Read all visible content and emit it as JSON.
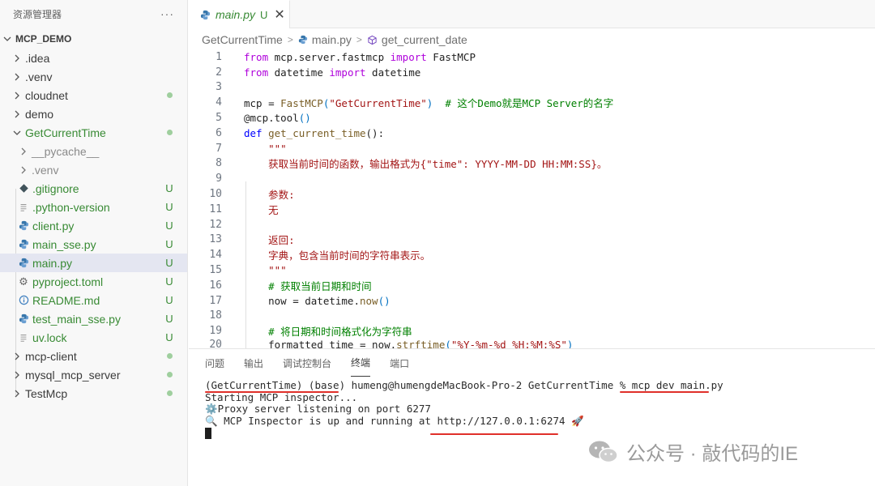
{
  "sidebar": {
    "title": "资源管理器",
    "more": "···",
    "root": "MCP_DEMO",
    "items": [
      {
        "label": ".idea",
        "status": ""
      },
      {
        "label": ".venv",
        "status": ""
      },
      {
        "label": "cloudnet",
        "status": "dot"
      },
      {
        "label": "demo",
        "status": ""
      },
      {
        "label": "GetCurrentTime",
        "status": "dot"
      },
      {
        "label": "__pycache__",
        "status": ""
      },
      {
        "label": ".venv",
        "status": ""
      },
      {
        "label": ".gitignore",
        "status": "U"
      },
      {
        "label": ".python-version",
        "status": "U"
      },
      {
        "label": "client.py",
        "status": "U"
      },
      {
        "label": "main_sse.py",
        "status": "U"
      },
      {
        "label": "main.py",
        "status": "U"
      },
      {
        "label": "pyproject.toml",
        "status": "U"
      },
      {
        "label": "README.md",
        "status": "U"
      },
      {
        "label": "test_main_sse.py",
        "status": "U"
      },
      {
        "label": "uv.lock",
        "status": "U"
      },
      {
        "label": "mcp-client",
        "status": "dot"
      },
      {
        "label": "mysql_mcp_server",
        "status": "dot"
      },
      {
        "label": "TestMcp",
        "status": "dot"
      }
    ]
  },
  "tab": {
    "label": "main.py",
    "status": "U",
    "close": "✕"
  },
  "breadcrumb": {
    "folder": "GetCurrentTime",
    "file": "main.py",
    "symbol": "get_current_date"
  },
  "code": {
    "line_numbers": [
      "1",
      "2",
      "3",
      "4",
      "5",
      "6",
      "7",
      "8",
      "9",
      "10",
      "11",
      "12",
      "13",
      "14",
      "15",
      "16",
      "17",
      "18",
      "19",
      "20"
    ],
    "l1": {
      "a": "from",
      "b": " mcp.server.fastmcp ",
      "c": "import",
      "d": " FastMCP"
    },
    "l2": {
      "a": "from",
      "b": " datetime ",
      "c": "import",
      "d": " datetime"
    },
    "l4": {
      "a": "mcp = ",
      "b": "FastMCP",
      "c": "(",
      "d": "\"GetCurrentTime\"",
      "e": ")",
      "f": "  # 这个Demo就是MCP Server的名字"
    },
    "l5": {
      "a": "@mcp.tool",
      "b": "()"
    },
    "l6": {
      "a": "def",
      "b": " ",
      "c": "get_current_time",
      "d": "():"
    },
    "l7": "    \"\"\"",
    "l8": "    获取当前时间的函数，输出格式为{\"time\": YYYY-MM-DD HH:MM:SS}。",
    "l10": "    参数:",
    "l11": "    无",
    "l13": "    返回:",
    "l14": "    字典，包含当前时间的字符串表示。",
    "l15": "    \"\"\"",
    "l16": "    # 获取当前日期和时间",
    "l17": {
      "a": "    now = datetime.",
      "b": "now",
      "c": "()"
    },
    "l19": "    # 将日期和时间格式化为字符串",
    "l20": {
      "a": "    formatted_time = now.",
      "b": "strftime",
      "c": "(",
      "d": "\"%Y-%m-%d %H:%M:%S\"",
      "e": ")"
    }
  },
  "panel": {
    "tabs": [
      "问题",
      "输出",
      "调试控制台",
      "终端",
      "端口"
    ],
    "active_tab": "终端",
    "terminal": {
      "line1": "(GetCurrentTime) (base) humeng@humengdeMacBook-Pro-2 GetCurrentTime % mcp dev main.py",
      "line2": "Starting MCP inspector...",
      "line3": "⚙️Proxy server listening on port 6277",
      "line4": "🔍 MCP Inspector is up and running at http://127.0.0.1:6274 🚀"
    }
  },
  "watermark": "公众号 · 敲代码的IE",
  "colors": {
    "untracked": "#388a34",
    "underline": "#e0302a",
    "selection": "#e4e6f1"
  }
}
